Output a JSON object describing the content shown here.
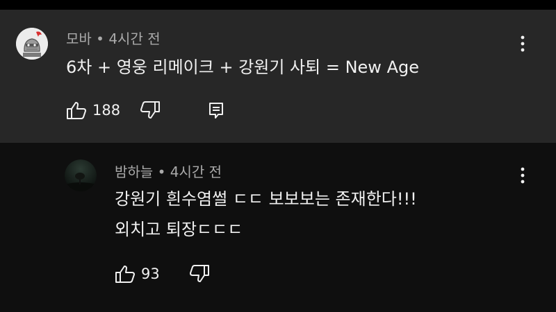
{
  "comments": [
    {
      "author": "모바",
      "separator": "•",
      "time": "4시간 전",
      "text": "6차 + 영웅 리메이크 + 강원기 사퇴 = New Age",
      "likes": "188",
      "avatar_icon": "knight-helmet-icon",
      "reply_icon": "reply-icon"
    },
    {
      "author": "밤하늘",
      "separator": "•",
      "time": "4시간 전",
      "text_line1": "강원기 흰수염썰 ㄷㄷ 보보보는 존재한다!!!",
      "text_line2": "외치고 퇴장ㄷㄷㄷ",
      "likes": "93",
      "avatar_icon": "night-sky-tree-icon"
    }
  ],
  "icons": {
    "like": "thumbs-up-icon",
    "dislike": "thumbs-down-icon",
    "more": "more-vert-icon"
  },
  "colors": {
    "top_comment_bg": "#272727",
    "page_bg": "#0f0f0f",
    "meta_text": "#aaaaaa",
    "body_text": "#f1f1f1"
  }
}
